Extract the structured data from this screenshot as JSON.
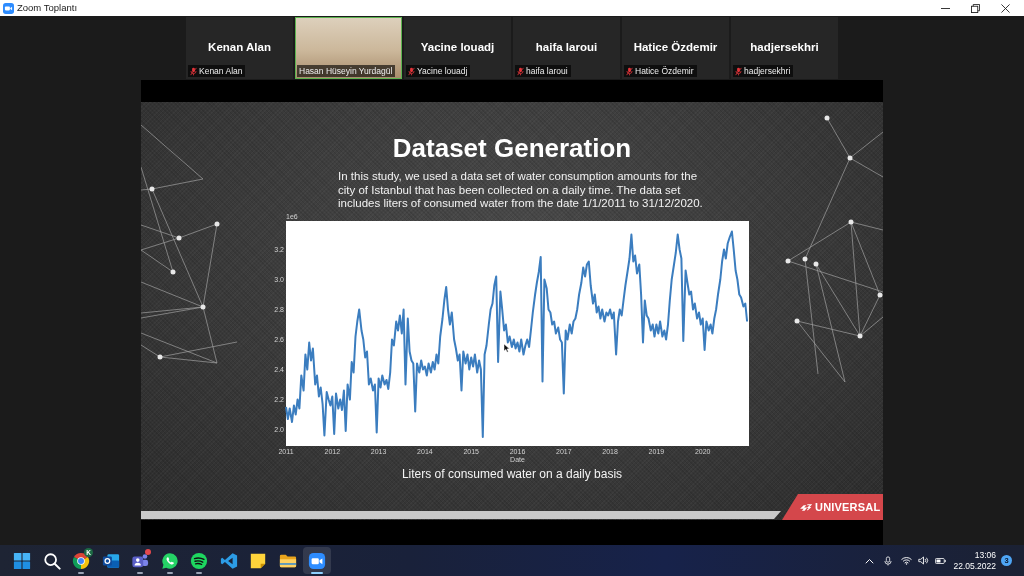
{
  "window": {
    "title": "Zoom Toplantı"
  },
  "participants": [
    {
      "name": "Kenan Alan",
      "label": "Kenan Alan",
      "video": false,
      "muted": true,
      "speaking": false
    },
    {
      "label": "Hasan Hüseyin Yurdagül",
      "video": true,
      "muted": false,
      "speaking": true
    },
    {
      "name": "Yacine louadj",
      "label": "Yacine louadj",
      "video": false,
      "muted": true,
      "speaking": false
    },
    {
      "name": "haifa laroui",
      "label": "haifa laroui",
      "video": false,
      "muted": true,
      "speaking": false
    },
    {
      "name": "Hatice Özdemir",
      "label": "Hatice Özdemir",
      "video": false,
      "muted": true,
      "speaking": false
    },
    {
      "name": "hadjersekhri",
      "label": "hadjersekhri",
      "video": false,
      "muted": true,
      "speaking": false
    }
  ],
  "slide": {
    "title": "Dataset Generation",
    "body": "In this study, we used a data set of water consumption amounts for the\ncity of Istanbul that has been collected on a daily time. The data set\nincludes liters of consumed water from the date 1/1/2011 to 31/12/2020.",
    "chart_data": {
      "type": "line",
      "xlabel": "Date",
      "xlim": [
        2011,
        2021
      ],
      "ylim": [
        1.89,
        3.39
      ],
      "xticks": [
        {
          "value": 2011,
          "label": "2011"
        },
        {
          "value": 2012,
          "label": "2012"
        },
        {
          "value": 2013,
          "label": "2013"
        },
        {
          "value": 2014,
          "label": "2014"
        },
        {
          "value": 2015,
          "label": "2015"
        },
        {
          "value": 2016,
          "label": "2016"
        },
        {
          "value": 2017,
          "label": "2017"
        },
        {
          "value": 2018,
          "label": "2018"
        },
        {
          "value": 2019,
          "label": "2019"
        },
        {
          "value": 2020,
          "label": "2020"
        }
      ],
      "yticks": [
        {
          "value": 2.0,
          "label": "2.0"
        },
        {
          "value": 2.2,
          "label": "2.2"
        },
        {
          "value": 2.4,
          "label": "2.4"
        },
        {
          "value": 2.6,
          "label": "2.6"
        },
        {
          "value": 2.8,
          "label": "2.8"
        },
        {
          "value": 3.0,
          "label": "3.0"
        },
        {
          "value": 3.2,
          "label": "3.2"
        }
      ],
      "annotations": [
        {
          "text": "1e6"
        }
      ],
      "x": [
        2011,
        2011.04,
        2011.08,
        2011.13,
        2011.17,
        2011.21,
        2011.25,
        2011.29,
        2011.33,
        2011.38,
        2011.42,
        2011.46,
        2011.5,
        2011.54,
        2011.58,
        2011.63,
        2011.67,
        2011.71,
        2011.75,
        2011.79,
        2011.83,
        2011.88,
        2011.92,
        2011.96,
        2012,
        2012.04,
        2012.08,
        2012.13,
        2012.17,
        2012.21,
        2012.25,
        2012.29,
        2012.33,
        2012.38,
        2012.42,
        2012.46,
        2012.5,
        2012.54,
        2012.58,
        2012.63,
        2012.67,
        2012.71,
        2012.75,
        2012.79,
        2012.83,
        2012.88,
        2012.92,
        2012.96,
        2013,
        2013.04,
        2013.08,
        2013.13,
        2013.17,
        2013.21,
        2013.25,
        2013.29,
        2013.33,
        2013.38,
        2013.42,
        2013.46,
        2013.5,
        2013.54,
        2013.58,
        2013.63,
        2013.67,
        2013.71,
        2013.75,
        2013.79,
        2013.83,
        2013.88,
        2013.92,
        2013.96,
        2014,
        2014.04,
        2014.08,
        2014.13,
        2014.17,
        2014.21,
        2014.25,
        2014.29,
        2014.33,
        2014.38,
        2014.42,
        2014.46,
        2014.5,
        2014.54,
        2014.58,
        2014.63,
        2014.67,
        2014.71,
        2014.75,
        2014.79,
        2014.83,
        2014.88,
        2014.92,
        2014.96,
        2015,
        2015.04,
        2015.08,
        2015.13,
        2015.17,
        2015.21,
        2015.25,
        2015.29,
        2015.33,
        2015.38,
        2015.42,
        2015.46,
        2015.5,
        2015.54,
        2015.58,
        2015.63,
        2015.67,
        2015.71,
        2015.75,
        2015.79,
        2015.83,
        2015.88,
        2015.92,
        2015.96,
        2016,
        2016.04,
        2016.08,
        2016.13,
        2016.17,
        2016.21,
        2016.25,
        2016.29,
        2016.33,
        2016.38,
        2016.42,
        2016.46,
        2016.5,
        2016.54,
        2016.58,
        2016.63,
        2016.67,
        2016.71,
        2016.75,
        2016.79,
        2016.83,
        2016.88,
        2016.92,
        2016.96,
        2017,
        2017.04,
        2017.08,
        2017.13,
        2017.17,
        2017.21,
        2017.25,
        2017.29,
        2017.33,
        2017.38,
        2017.42,
        2017.46,
        2017.5,
        2017.54,
        2017.58,
        2017.63,
        2017.67,
        2017.71,
        2017.75,
        2017.79,
        2017.83,
        2017.88,
        2017.92,
        2017.96,
        2018,
        2018.04,
        2018.08,
        2018.13,
        2018.17,
        2018.21,
        2018.25,
        2018.29,
        2018.33,
        2018.38,
        2018.42,
        2018.46,
        2018.5,
        2018.54,
        2018.58,
        2018.63,
        2018.67,
        2018.71,
        2018.75,
        2018.79,
        2018.83,
        2018.88,
        2018.92,
        2018.96,
        2019,
        2019.04,
        2019.08,
        2019.13,
        2019.17,
        2019.21,
        2019.25,
        2019.29,
        2019.33,
        2019.38,
        2019.42,
        2019.46,
        2019.5,
        2019.54,
        2019.58,
        2019.63,
        2019.67,
        2019.71,
        2019.75,
        2019.79,
        2019.83,
        2019.88,
        2019.92,
        2019.96,
        2020,
        2020.04,
        2020.08,
        2020.13,
        2020.17,
        2020.21,
        2020.25,
        2020.29,
        2020.33,
        2020.38,
        2020.42,
        2020.46,
        2020.5,
        2020.54,
        2020.58,
        2020.63,
        2020.67,
        2020.71,
        2020.75,
        2020.79,
        2020.83,
        2020.88,
        2020.92,
        2020.96
      ],
      "series": [
        {
          "values": [
            2.15,
            2.07,
            2.14,
            2.05,
            2.16,
            2.1,
            2.2,
            2.14,
            2.36,
            2.26,
            2.5,
            2.4,
            2.58,
            2.46,
            2.54,
            2.3,
            2.36,
            2.22,
            2.28,
            2.17,
            1.96,
            2.25,
            2.2,
            2.16,
            2.22,
            1.97,
            2.24,
            2.14,
            2.2,
            2.13,
            2.26,
            1.99,
            2.3,
            2.2,
            2.45,
            2.38,
            2.62,
            2.72,
            2.8,
            2.66,
            2.6,
            2.48,
            2.52,
            2.3,
            2.34,
            2.26,
            2.3,
            1.98,
            2.34,
            2.28,
            2.36,
            2.3,
            2.33,
            2.27,
            2.38,
            2.6,
            2.56,
            2.72,
            2.66,
            2.76,
            2.64,
            2.8,
            2.3,
            2.74,
            2.52,
            2.46,
            2.44,
            2.12,
            2.44,
            2.38,
            2.46,
            2.4,
            2.42,
            2.36,
            2.44,
            2.38,
            2.45,
            2.4,
            2.5,
            2.44,
            2.62,
            2.74,
            2.86,
            2.95,
            2.8,
            2.7,
            2.78,
            2.6,
            2.54,
            2.46,
            2.5,
            2.26,
            2.52,
            2.44,
            2.5,
            2.4,
            2.48,
            2.42,
            2.5,
            2.38,
            2.46,
            2.4,
            1.95,
            2.5,
            2.56,
            2.7,
            2.8,
            2.84,
            2.96,
            3.02,
            2.45,
            2.92,
            2.8,
            2.66,
            2.7,
            2.58,
            2.62,
            2.55,
            2.6,
            2.54,
            2.58,
            2.52,
            2.6,
            2.5,
            2.56,
            2.6,
            2.55,
            2.66,
            2.78,
            2.9,
            2.98,
            3.05,
            3.15,
            2.32,
            3.0,
            2.94,
            2.8,
            2.78,
            2.7,
            2.72,
            2.64,
            2.68,
            2.6,
            2.58,
            2.24,
            2.66,
            2.6,
            2.7,
            2.64,
            2.72,
            2.74,
            2.8,
            2.9,
            2.98,
            3.08,
            3.02,
            3.1,
            3.12,
            2.96,
            2.84,
            2.9,
            2.78,
            2.82,
            2.74,
            2.8,
            2.72,
            2.78,
            2.76,
            2.8,
            2.74,
            2.78,
            2.5,
            2.72,
            2.8,
            2.76,
            2.86,
            2.96,
            3.06,
            3.14,
            3.3,
            3.12,
            3.16,
            3.04,
            3.1,
            2.9,
            2.58,
            2.86,
            2.76,
            2.74,
            2.66,
            2.7,
            2.62,
            2.7,
            2.64,
            2.72,
            2.62,
            2.66,
            2.6,
            2.7,
            2.86,
            3.0,
            3.1,
            3.18,
            3.3,
            3.2,
            3.14,
            2.59,
            3.06,
            2.98,
            2.9,
            2.92,
            2.8,
            2.84,
            2.74,
            2.78,
            2.7,
            2.74,
            2.53,
            2.72,
            2.66,
            2.7,
            2.64,
            2.74,
            2.8,
            2.9,
            3.0,
            3.12,
            3.2,
            3.14,
            3.24,
            3.28,
            3.32,
            3.2,
            3.06,
            3.0,
            2.9,
            2.88,
            2.82,
            2.84,
            2.72
          ]
        }
      ]
    },
    "caption": "Liters of consumed water on a daily basis",
    "logo": "UNIVERSAL"
  },
  "taskbar": {
    "apps": [
      {
        "kind": "start",
        "running": false,
        "active": false,
        "alert": false
      },
      {
        "kind": "search",
        "running": false,
        "active": false,
        "alert": false
      },
      {
        "kind": "browser",
        "running": true,
        "active": false,
        "alert": false,
        "badge": "K"
      },
      {
        "kind": "mail",
        "running": false,
        "active": false,
        "alert": false
      },
      {
        "kind": "team-chat",
        "running": true,
        "active": false,
        "alert": true
      },
      {
        "kind": "messenger",
        "running": true,
        "active": false,
        "alert": false
      },
      {
        "kind": "music",
        "running": true,
        "active": false,
        "alert": false
      },
      {
        "kind": "code-editor",
        "running": false,
        "active": false,
        "alert": false
      },
      {
        "kind": "notes",
        "running": false,
        "active": false,
        "alert": false
      },
      {
        "kind": "files",
        "running": false,
        "active": false,
        "alert": false
      },
      {
        "kind": "video-meeting",
        "running": true,
        "active": true,
        "alert": false
      }
    ],
    "time": "13:06",
    "date": "22.05.2022",
    "notifications": "3"
  }
}
